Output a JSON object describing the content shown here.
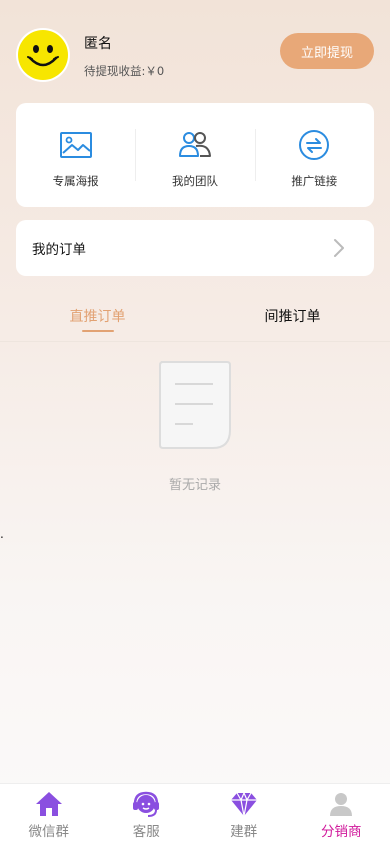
{
  "user": {
    "name": "匿名",
    "earnings_text": "待提现收益:￥0",
    "withdraw_label": "立即提现"
  },
  "tools": [
    {
      "label": "专属海报",
      "icon": "image-icon"
    },
    {
      "label": "我的团队",
      "icon": "team-icon"
    },
    {
      "label": "推广链接",
      "icon": "share-link-icon"
    }
  ],
  "orders": {
    "label": "我的订单"
  },
  "tabs": [
    {
      "label": "直推订单",
      "active": true
    },
    {
      "label": "间推订单",
      "active": false
    }
  ],
  "empty": {
    "text": "暂无记录"
  },
  "stray_mark": ".",
  "bottom_nav": [
    {
      "label": "微信群",
      "icon": "home-icon"
    },
    {
      "label": "客服",
      "icon": "headset-icon"
    },
    {
      "label": "建群",
      "icon": "diamond-icon"
    },
    {
      "label": "分销商",
      "icon": "user-icon",
      "active": true
    }
  ],
  "colors": {
    "accent": "#e8a878",
    "tab_active": "#e2a273",
    "nav_active": "#d0199b",
    "icon_blue": "#2b8ce0",
    "nav_purple": "#8a4fe0"
  }
}
